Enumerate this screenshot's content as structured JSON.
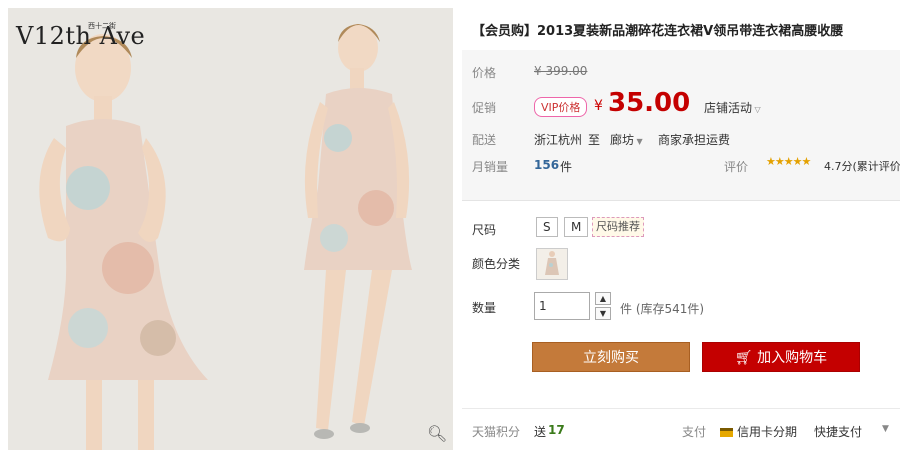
{
  "gallery": {
    "brand_logo": "V12th Ave",
    "brand_sub": "西十二街",
    "zoom_icon": "zoom-icon"
  },
  "product": {
    "title": "【会员购】2013夏装新品潮碎花连衣裙V领吊带连衣裙高腰收腰",
    "price_label": "价格",
    "original_price": "¥ 399.00",
    "promo_label": "促销",
    "vip_tag": "VIP价格",
    "currency": "¥",
    "promo_price": "35.00",
    "shop_activity": "店铺活动",
    "shipping_label": "配送",
    "ship_from": "浙江杭州",
    "ship_to_word": "至",
    "ship_to": "廊坊",
    "ship_fee": "商家承担运费",
    "monthly_label": "月销量",
    "monthly_sales": "156",
    "monthly_unit": "件",
    "rating_label": "评价",
    "stars": "★★★★★",
    "rating": "4.7分(累计评价",
    "size_label": "尺码",
    "sizes": [
      "S",
      "M"
    ],
    "size_recommend": "尺码推荐",
    "color_label": "颜色分类",
    "quantity_label": "数量",
    "quantity_value": "1",
    "stock": "件 (库存541件)",
    "buy_now": "立刻购买",
    "add_to_cart": "加入购物车",
    "points_label": "天猫积分",
    "points_prefix": "送",
    "points_value": "17",
    "pay_label": "支付",
    "pay_card": "信用卡分期",
    "pay_quick": "快捷支付"
  },
  "colors": {
    "promo_price": "#c40000",
    "buy_now_bg": "#c47a3a",
    "add_cart_bg": "#c40000",
    "sales_count": "#336699",
    "points": "#3a7a1a"
  }
}
